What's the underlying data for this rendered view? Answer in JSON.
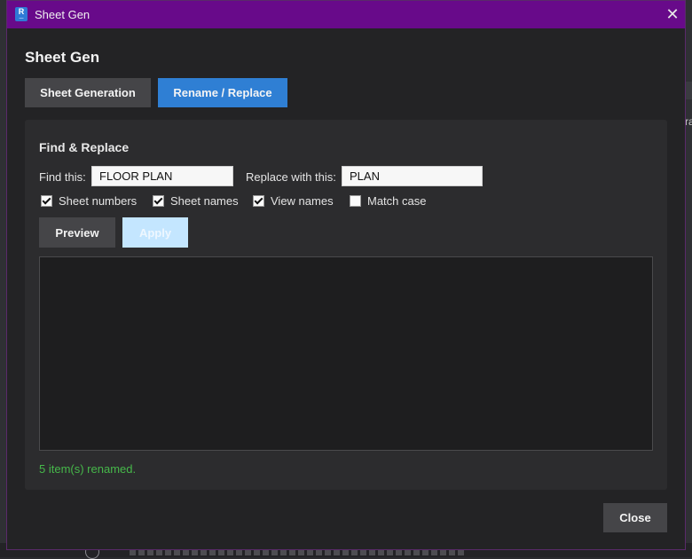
{
  "window": {
    "title": "Sheet Gen",
    "icon_letter": "R",
    "icon_caption": "—",
    "close_glyph": "✕",
    "titlebar_color": "#680a8a"
  },
  "heading": "Sheet Gen",
  "tabs": [
    {
      "label": "Sheet Generation",
      "active": false
    },
    {
      "label": "Rename / Replace",
      "active": true
    }
  ],
  "find_replace": {
    "title": "Find & Replace",
    "find_label": "Find this:",
    "find_value": "FLOOR PLAN",
    "replace_label": "Replace with this:",
    "replace_value": "PLAN",
    "options": [
      {
        "label": "Sheet numbers",
        "checked": true
      },
      {
        "label": "Sheet names",
        "checked": true
      },
      {
        "label": "View names",
        "checked": true
      },
      {
        "label": "Match case",
        "checked": false
      }
    ],
    "preview_label": "Preview",
    "apply_label": "Apply",
    "status_text": "5 item(s) renamed.",
    "status_color": "#46b84a"
  },
  "close_label": "Close",
  "background": {
    "edge_text": "ra"
  }
}
